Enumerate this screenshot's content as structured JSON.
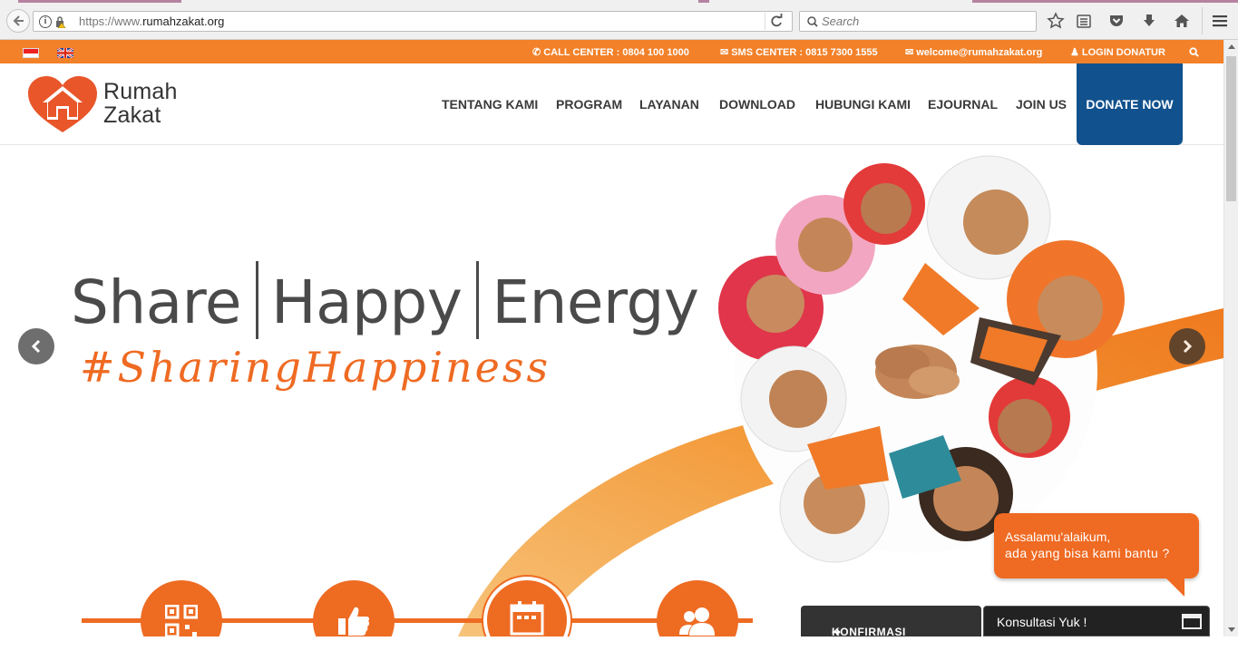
{
  "browser": {
    "url_prefix": "https://www.",
    "url_domain": "rumahzakat.org",
    "search_placeholder": "Search"
  },
  "topbar": {
    "call_center": "CALL CENTER : 0804 100 1000",
    "sms_center": "SMS CENTER : 0815 7300 1555",
    "email": "welcome@rumahzakat.org",
    "login": "LOGIN DONATUR"
  },
  "logo": {
    "line1": "Rumah",
    "line2": "Zakat"
  },
  "nav": {
    "items": [
      "TENTANG KAMI",
      "PROGRAM",
      "LAYANAN",
      "DOWNLOAD",
      "HUBUNGI KAMI",
      "EJOURNAL",
      "JOIN US"
    ],
    "donate": "DONATE NOW"
  },
  "hero": {
    "word1": "Share",
    "word2": "Happy",
    "word3": "Energy",
    "hashtag": "#SharingHappiness"
  },
  "chat": {
    "line1": "Assalamu'alaikum,",
    "line2": "ada yang bisa kami bantu ?",
    "konfirmasi": "KONFIRMASI DONASI",
    "konsultasi": "Konsultasi Yuk !"
  },
  "colors": {
    "orange": "#f28129",
    "donate_blue": "#11518d",
    "text_dark": "#3a3a3a"
  }
}
